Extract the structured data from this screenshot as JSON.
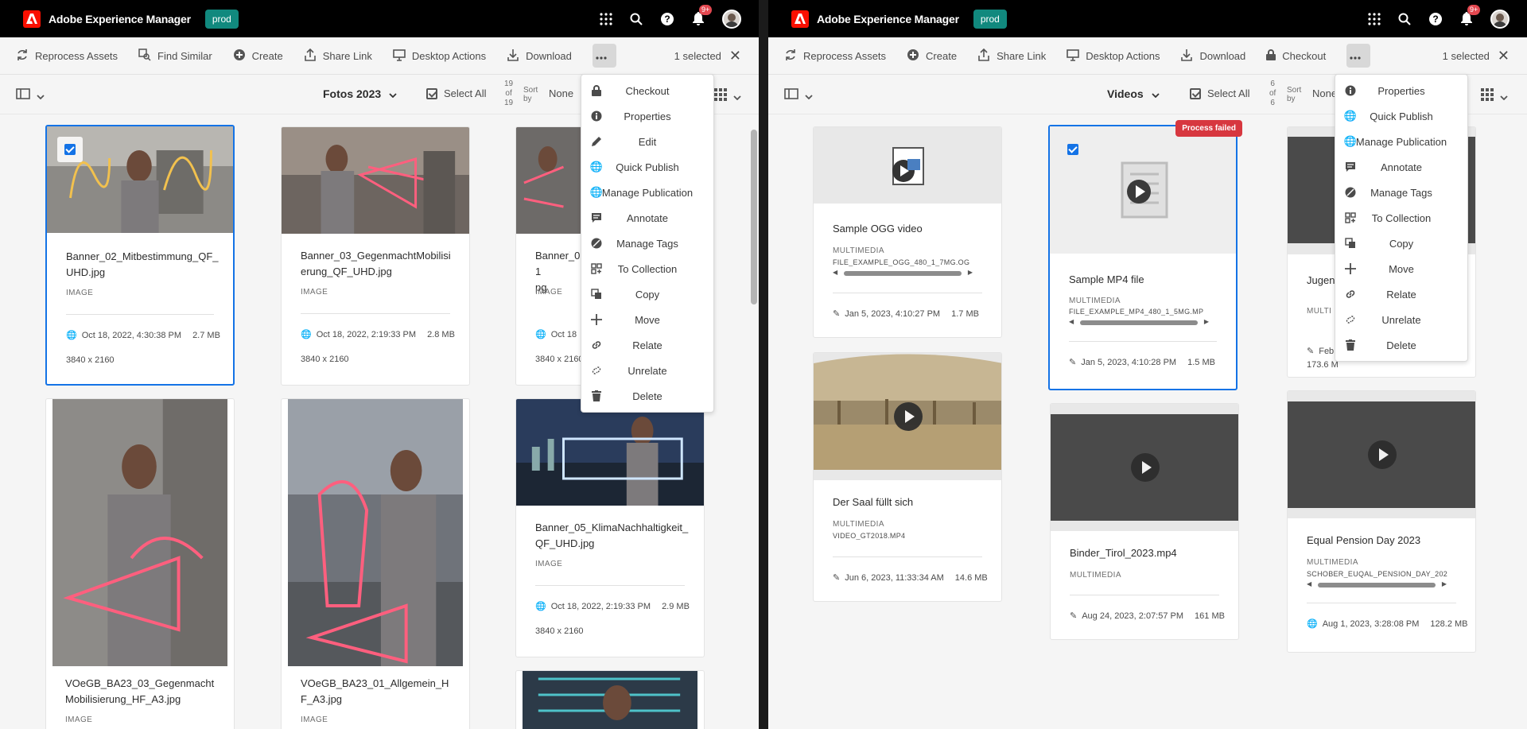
{
  "left": {
    "app_title": "Adobe Experience Manager",
    "env": "prod",
    "notif_count": "9+",
    "actions": [
      {
        "label": "Reprocess Assets",
        "icon": "reprocess-icon"
      },
      {
        "label": "Find Similar",
        "icon": "find-similar-icon"
      },
      {
        "label": "Create",
        "icon": "plus-circle-icon"
      },
      {
        "label": "Share Link",
        "icon": "share-icon"
      },
      {
        "label": "Desktop Actions",
        "icon": "desktop-icon"
      },
      {
        "label": "Download",
        "icon": "download-icon"
      }
    ],
    "selected_text": "1 selected",
    "folder": "Fotos 2023",
    "select_all": "Select All",
    "count_top": "19",
    "count_of": "of",
    "count_bottom": "19",
    "sort_label_1": "Sort",
    "sort_label_2": "by",
    "sort_value": "None",
    "menu": [
      "Checkout",
      "Properties",
      "Edit",
      "Quick Publish",
      "Manage Publication",
      "Annotate",
      "Manage Tags",
      "To Collection",
      "Copy",
      "Move",
      "Relate",
      "Unrelate",
      "Delete"
    ],
    "cards": [
      {
        "title": "Banner_02_Mitbestimmung_QF_UHD.jpg",
        "type": "IMAGE",
        "date": "Oct 18, 2022, 4:30:38 PM",
        "size": "2.7 MB",
        "dims": "3840 x 2160"
      },
      {
        "title": "Banner_03_GegenmachtMobilisierung_QF_UHD.jpg",
        "type": "IMAGE",
        "date": "Oct 18, 2022, 2:19:33 PM",
        "size": "2.8 MB",
        "dims": "3840 x 2160"
      },
      {
        "title": "Banner_01",
        "title2": "pg",
        "type": "IMAGE",
        "date": "Oct 18",
        "size": "",
        "dims": "3840 x 2160"
      },
      {
        "title": "VOeGB_BA23_03_Gegenmacht Mobilisierung_HF_A3.jpg",
        "type": "IMAGE"
      },
      {
        "title": "VOeGB_BA23_01_Allgemein_HF_A3.jpg",
        "type": "IMAGE"
      },
      {
        "title": "Banner_05_KlimaNachhaltigkeit_QF_UHD.jpg",
        "type": "IMAGE",
        "date": "Oct 18, 2022, 2:19:33 PM",
        "size": "2.9 MB",
        "dims": "3840 x 2160"
      }
    ]
  },
  "right": {
    "app_title": "Adobe Experience Manager",
    "env": "prod",
    "notif_count": "9+",
    "actions": [
      {
        "label": "Reprocess Assets",
        "icon": "reprocess-icon"
      },
      {
        "label": "Create",
        "icon": "plus-circle-icon"
      },
      {
        "label": "Share Link",
        "icon": "share-icon"
      },
      {
        "label": "Desktop Actions",
        "icon": "desktop-icon"
      },
      {
        "label": "Download",
        "icon": "download-icon"
      },
      {
        "label": "Checkout",
        "icon": "lock-icon"
      }
    ],
    "selected_text": "1 selected",
    "folder": "Videos",
    "select_all": "Select All",
    "count_top": "6",
    "count_of": "of",
    "count_bottom": "6",
    "sort_label_1": "Sort",
    "sort_label_2": "by",
    "sort_value": "None",
    "menu": [
      "Properties",
      "Quick Publish",
      "Manage Publication",
      "Annotate",
      "Manage Tags",
      "To Collection",
      "Copy",
      "Move",
      "Relate",
      "Unrelate",
      "Delete"
    ],
    "cards": [
      {
        "title": "Sample OGG video",
        "type": "MULTIMEDIA",
        "file": "FILE_EXAMPLE_OGG_480_1_7MG.OG",
        "date": "Jan 5, 2023, 4:10:27 PM",
        "size": "1.7 MB"
      },
      {
        "title": "Sample MP4 file",
        "type": "MULTIMEDIA",
        "file": "FILE_EXAMPLE_MP4_480_1_5MG.MP",
        "date": "Jan 5, 2023, 4:10:28 PM",
        "size": "1.5 MB",
        "status": "Process failed"
      },
      {
        "title": "Jugend",
        "type": "MULTI",
        "date": "Feb",
        "size": "173.6 M"
      },
      {
        "title": "Der Saal füllt sich",
        "type": "MULTIMEDIA",
        "file": "VIDEO_GT2018.MP4",
        "date": "Jun 6, 2023, 11:33:34 AM",
        "size": "14.6 MB"
      },
      {
        "title": "Binder_Tirol_2023.mp4",
        "type": "MULTIMEDIA",
        "date": "Aug 24, 2023, 2:07:57 PM",
        "size": "161 MB"
      },
      {
        "title": "Equal Pension Day 2023",
        "type": "MULTIMEDIA",
        "file": "SCHOBER_EUQAL_PENSION_DAY_202",
        "date": "Aug 1, 2023, 3:28:08 PM",
        "size": "128.2 MB"
      }
    ]
  },
  "colors": {
    "accent": "#1473e6",
    "env_badge": "#11897e",
    "failed": "#d7373f",
    "brand": "#fa0f00"
  }
}
